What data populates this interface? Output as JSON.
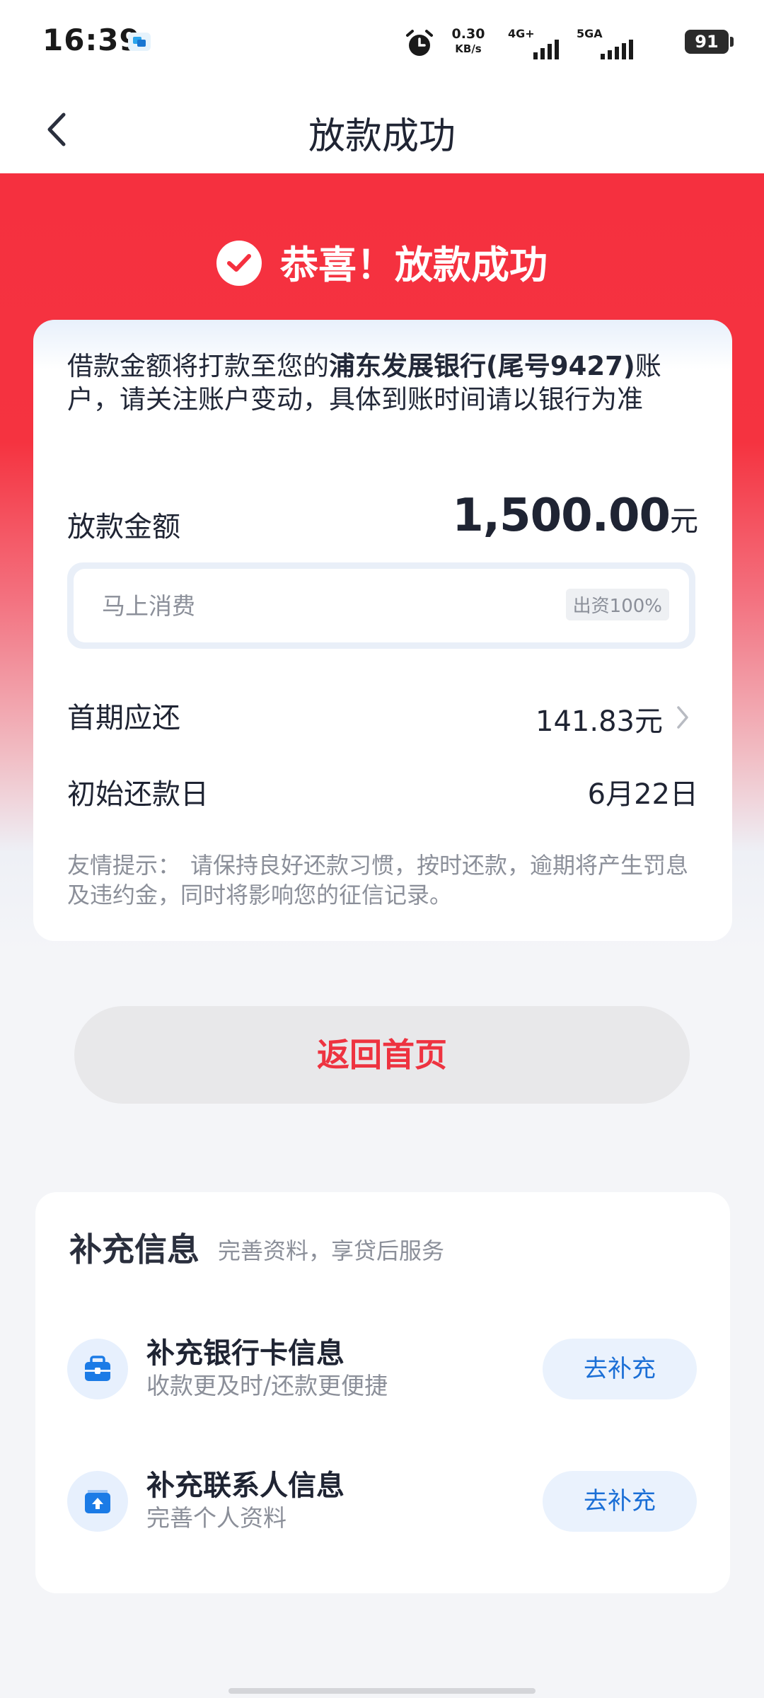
{
  "status_bar": {
    "time": "16:39",
    "net_speed_value": "0.30",
    "net_speed_unit": "KB/s",
    "sim1_label": "4G+",
    "sim2_label": "5GA",
    "battery": "91"
  },
  "nav": {
    "title": "放款成功"
  },
  "hero": {
    "title": "恭喜！放款成功"
  },
  "loan": {
    "notice_prefix": "借款金额将打款至您的",
    "notice_bank": "浦东发展银行(尾号9427)",
    "notice_suffix": "账户，请关注账户变动，具体到账时间请以银行为准",
    "amount_label": "放款金额",
    "amount_value": "1,500.00",
    "amount_unit": "元",
    "lender_name": "马上消费",
    "lender_share": "出资100%",
    "first_repay_label": "首期应还",
    "first_repay_value": "141.83元",
    "start_date_label": "初始还款日",
    "start_date_value": "6月22日",
    "tips_label": "友情提示：",
    "tips_text": "请保持良好还款习惯，按时还款，逾期将产生罚息及违约金，同时将影响您的征信记录。"
  },
  "home_button": {
    "label": "返回首页"
  },
  "supplement": {
    "title": "补充信息",
    "subtitle": "完善资料，享贷后服务",
    "items": [
      {
        "icon": "briefcase-icon",
        "name": "补充银行卡信息",
        "desc": "收款更及时/还款更便捷",
        "button": "去补充"
      },
      {
        "icon": "upload-folder-icon",
        "name": "补充联系人信息",
        "desc": "完善个人资料",
        "button": "去补充"
      }
    ]
  },
  "colors": {
    "accent_red": "#f5303f",
    "link_blue": "#1b6fd6"
  }
}
